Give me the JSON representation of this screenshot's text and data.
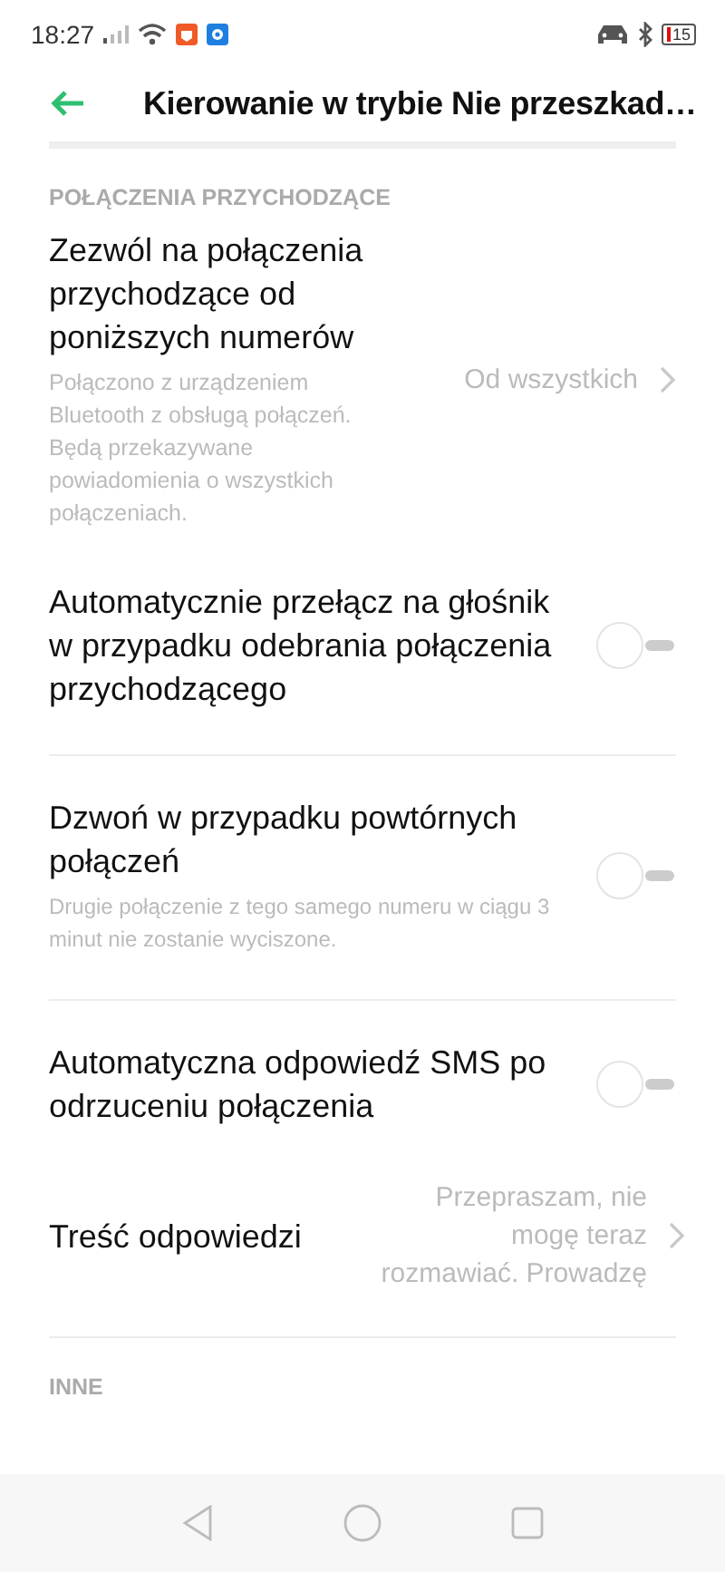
{
  "status_bar": {
    "time": "18:27",
    "battery": "15"
  },
  "header": {
    "title": "Kierowanie w trybie Nie przeszkad…"
  },
  "sections": [
    {
      "header": "POŁĄCZENIA PRZYCHODZĄCE",
      "groups": [
        [
          {
            "kind": "link",
            "title": "Zezwól na połączenia przychodzące od poniższych numerów",
            "subtitle": "Połączono z urządzeniem Bluetooth z obsługą połączeń. Będą przekazywane powiadomienia o wszystkich połączeniach.",
            "value": "Od wszystkich"
          },
          {
            "kind": "toggle",
            "title": "Automatycznie przełącz na głośnik w przypadku odebrania połączenia przychodzącego",
            "on": false
          }
        ],
        [
          {
            "kind": "toggle",
            "title": "Dzwoń w przypadku powtórnych połączeń",
            "subtitle": "Drugie połączenie z tego samego numeru w ciągu 3 minut nie zostanie wyciszone.",
            "on": false
          }
        ],
        [
          {
            "kind": "toggle",
            "title": "Automatyczna odpowiedź SMS po odrzuceniu połączenia",
            "on": false
          },
          {
            "kind": "link",
            "title": "Treść odpowiedzi",
            "value": "Przepraszam, nie mogę teraz rozmawiać. Prowadzę"
          }
        ]
      ]
    },
    {
      "header": "INNE"
    }
  ]
}
